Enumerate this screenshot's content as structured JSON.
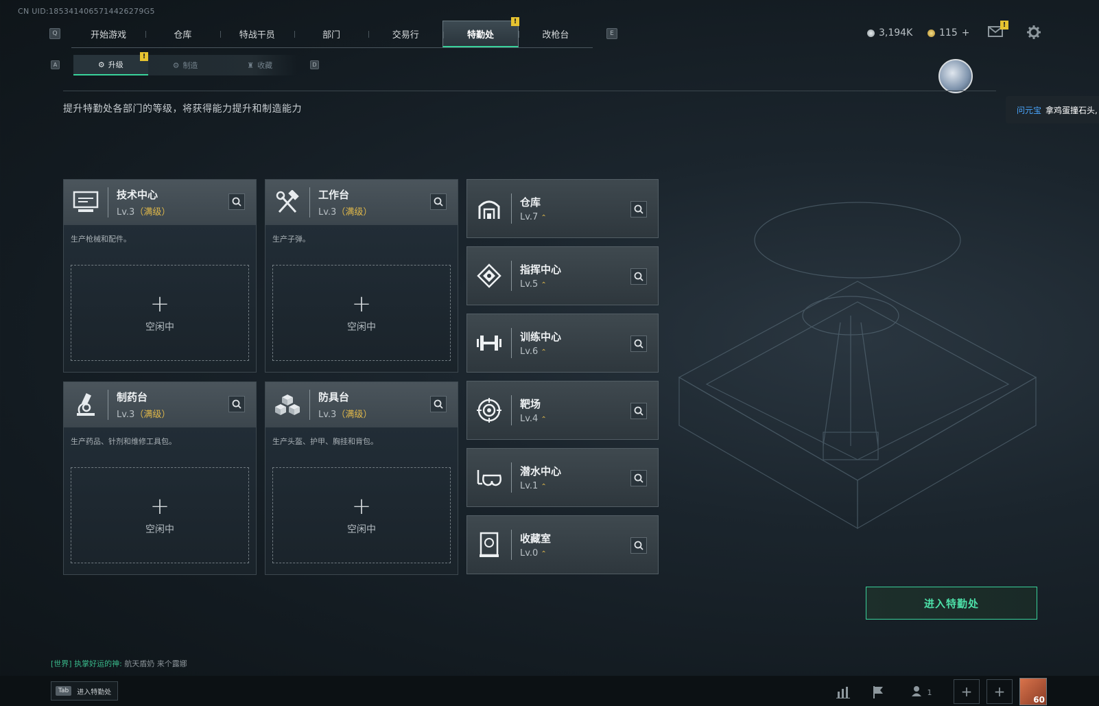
{
  "uid": "CN UID:1853414065714426279G5",
  "keys": {
    "prev_tab": "Q",
    "next_tab": "E",
    "prev_sub": "A",
    "next_sub": "D"
  },
  "nav": {
    "tabs": [
      "开始游戏",
      "仓库",
      "特战干员",
      "部门",
      "交易行",
      "特勤处",
      "改枪台"
    ],
    "active_index": 5
  },
  "subnav": {
    "tabs": [
      "升级",
      "制造",
      "收藏"
    ],
    "active_index": 0
  },
  "currency": {
    "coins": "3,194K",
    "tickets": "115",
    "tickets_add": "+"
  },
  "warning_mark": "!",
  "description": "提升特勤处各部门的等级，将获得能力提升和制造能力",
  "popup": {
    "name": "问元宝",
    "message": "拿鸡蛋撞石头,"
  },
  "craft_cards": [
    {
      "icon": "monitor-icon",
      "title": "技术中心",
      "level": "Lv.3",
      "max_tag": "（满级）",
      "text": "生产枪械和配件。",
      "slot_plus": "+",
      "slot_status": "空闲中"
    },
    {
      "icon": "hammer-wrench-icon",
      "title": "工作台",
      "level": "Lv.3",
      "max_tag": "（满级）",
      "text": "生产子弹。",
      "slot_plus": "+",
      "slot_status": "空闲中"
    },
    {
      "icon": "microscope-icon",
      "title": "制药台",
      "level": "Lv.3",
      "max_tag": "（满级）",
      "text": "生产药品、针剂和维修工具包。",
      "slot_plus": "+",
      "slot_status": "空闲中"
    },
    {
      "icon": "cubes-icon",
      "title": "防具台",
      "level": "Lv.3",
      "max_tag": "（满级）",
      "text": "生产头盔、护甲、胸挂和背包。",
      "slot_plus": "+",
      "slot_status": "空闲中"
    }
  ],
  "dept_cards": [
    {
      "icon": "vault-icon",
      "title": "仓库",
      "level": "Lv.7"
    },
    {
      "icon": "command-icon",
      "title": "指挥中心",
      "level": "Lv.5"
    },
    {
      "icon": "dumbbell-icon",
      "title": "训练中心",
      "level": "Lv.6"
    },
    {
      "icon": "target-icon",
      "title": "靶场",
      "level": "Lv.4"
    },
    {
      "icon": "diving-mask-icon",
      "title": "潜水中心",
      "level": "Lv.1"
    },
    {
      "icon": "collection-icon",
      "title": "收藏室",
      "level": "Lv.0"
    }
  ],
  "enter_button": "进入特勤处",
  "chat": {
    "channel": "[世界]",
    "sender": "执掌好运的神:",
    "message": "航天盾奶 来个露娜"
  },
  "tab_hint": {
    "key": "Tab",
    "label": "进入特勤处"
  },
  "bottom": {
    "friends_count": "1",
    "level": "60"
  }
}
